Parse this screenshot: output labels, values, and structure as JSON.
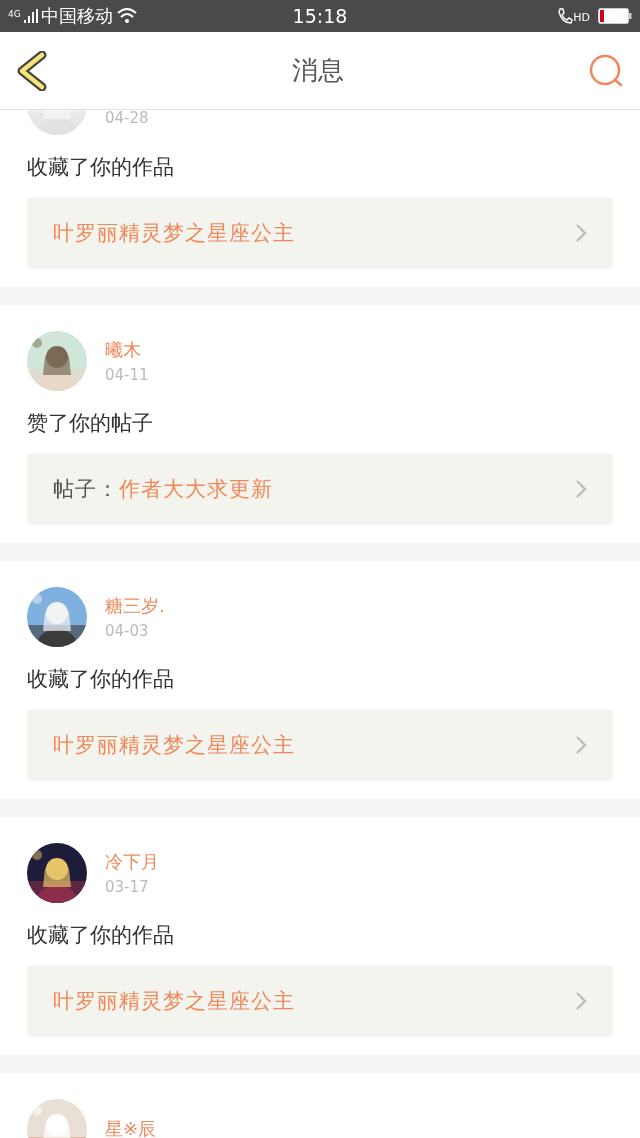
{
  "status_bar": {
    "network": "4G",
    "carrier": "中国移动",
    "time": "15:18",
    "call_badge": "HD"
  },
  "header": {
    "title": "消息"
  },
  "notifications": [
    {
      "date": "04-28",
      "action": "收藏了你的作品",
      "link": {
        "title": "叶罗丽精灵梦之星座公主"
      }
    },
    {
      "user": "曦木",
      "date": "04-11",
      "action": "赞了你的帖子",
      "link": {
        "prefix": "帖子：",
        "title": "作者大大求更新"
      }
    },
    {
      "user": "糖三岁.",
      "date": "04-03",
      "action": "收藏了你的作品",
      "link": {
        "title": "叶罗丽精灵梦之星座公主"
      }
    },
    {
      "user": "冷下月",
      "date": "03-17",
      "action": "收藏了你的作品",
      "link": {
        "title": "叶罗丽精灵梦之星座公主"
      }
    },
    {
      "user": "星※辰"
    }
  ]
}
